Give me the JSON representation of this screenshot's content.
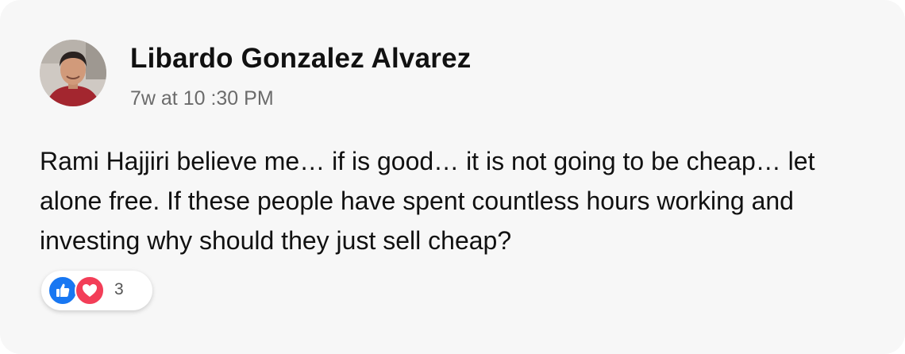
{
  "comment": {
    "author_name": "Libardo Gonzalez Alvarez",
    "timestamp": "7w at 10 :30 PM",
    "body": "Rami Hajjiri believe me… if is good… it is not going to be cheap… let alone free. If these people have spent countless hours working and investing why should they just sell cheap?",
    "reactions": {
      "icons": [
        "like-icon",
        "love-icon"
      ],
      "count": "3"
    }
  },
  "colors": {
    "card_background": "#f7f7f7",
    "like_blue": "#1877f2",
    "love_red": "#f33e58",
    "timestamp_gray": "#6b6b6b"
  }
}
